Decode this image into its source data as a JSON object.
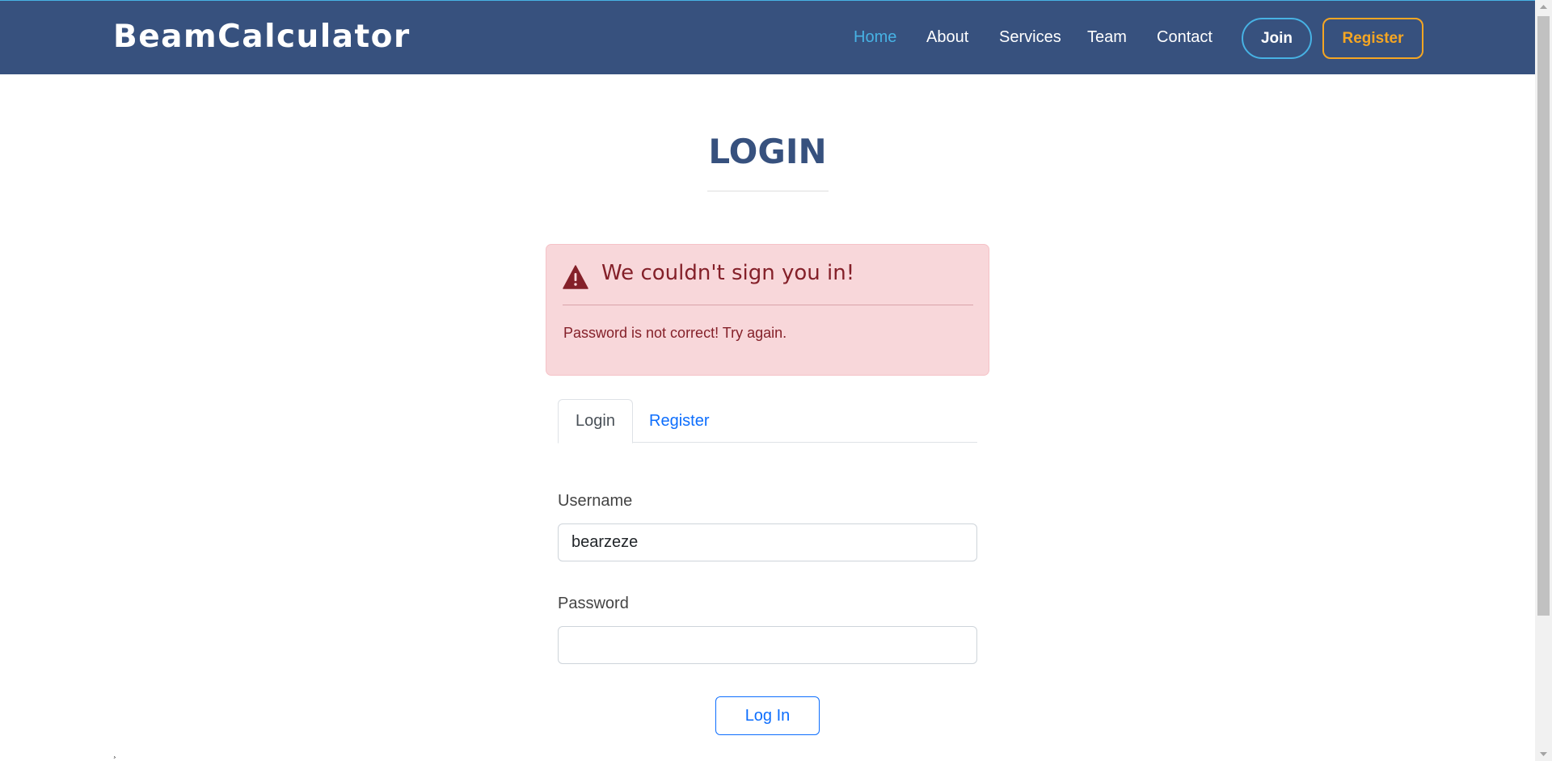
{
  "header": {
    "brand": "BeamCalculator",
    "nav": [
      {
        "label": "Home",
        "active": true
      },
      {
        "label": "About"
      },
      {
        "label": "Services"
      },
      {
        "label": "Team"
      },
      {
        "label": "Contact"
      }
    ],
    "join_label": "Join",
    "register_label": "Register"
  },
  "page": {
    "title": "LOGIN"
  },
  "alert": {
    "heading": "We couldn't sign you in!",
    "message": "Password is not correct! Try again.",
    "icon": "warning-triangle-icon"
  },
  "tabs": [
    {
      "label": "Login",
      "active": true
    },
    {
      "label": "Register",
      "active": false
    }
  ],
  "form": {
    "username_label": "Username",
    "username_value": "bearzeze",
    "password_label": "Password",
    "password_value": "",
    "submit_label": "Log In"
  },
  "footer_fragment": "¸",
  "colors": {
    "header_bg": "#37517e",
    "accent_blue": "#47b2e4",
    "accent_orange": "#f5a623",
    "alert_bg": "#f8d7da",
    "alert_text": "#842029",
    "link_blue": "#0d6efd"
  }
}
